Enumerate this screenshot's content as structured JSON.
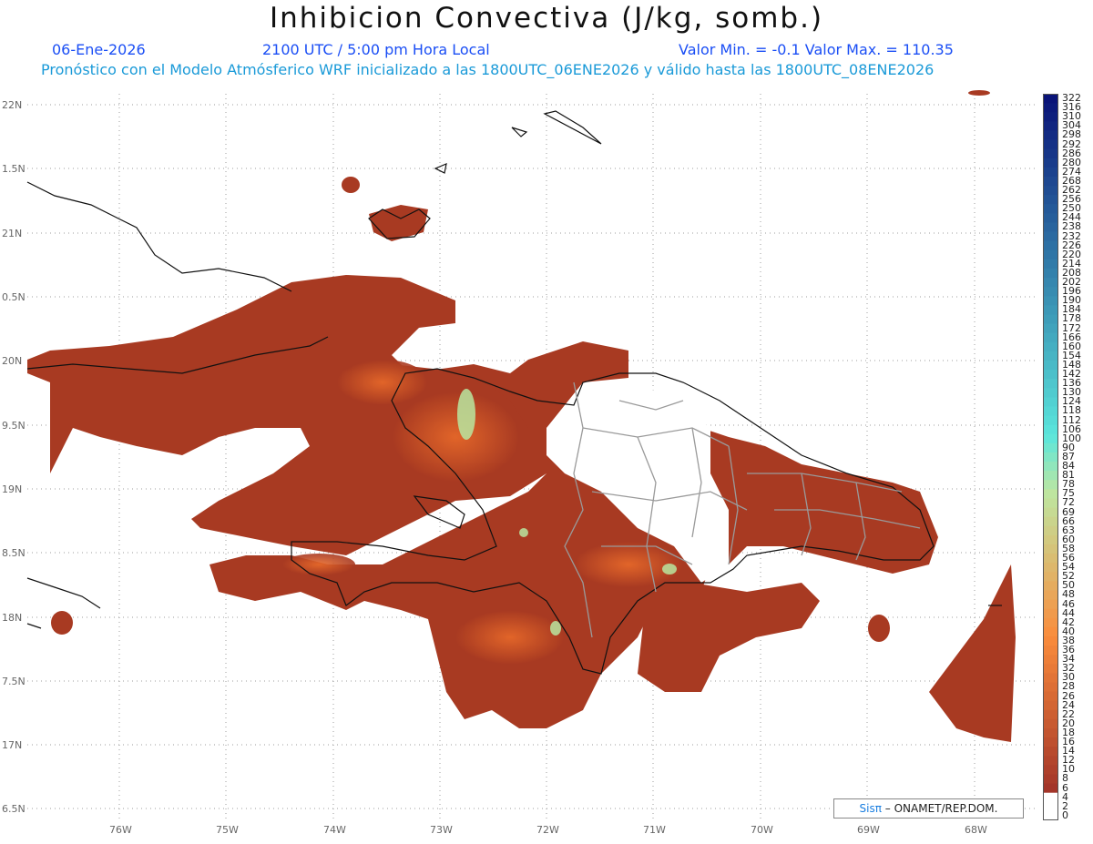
{
  "header": {
    "title": "Inhibicion Convectiva (J/kg, somb.)",
    "date": "06-Ene-2026",
    "time": "2100 UTC / 5:00 pm Hora Local",
    "minmax": "Valor Min. = -0.1  Valor Max. = 110.35",
    "forecast": "Pronóstico con el Modelo Atmósferico WRF inicializado a las 1800UTC_06ENE2026 y válido hasta las  1800UTC_08ENE2026"
  },
  "axes": {
    "lat_labels": [
      "22N",
      "1.5N",
      "21N",
      "0.5N",
      "20N",
      "9.5N",
      "19N",
      "8.5N",
      "18N",
      "7.5N",
      "17N",
      "6.5N"
    ],
    "lon_labels": [
      "76W",
      "75W",
      "74W",
      "73W",
      "72W",
      "71W",
      "70W",
      "69W",
      "68W"
    ]
  },
  "credit": {
    "brand": "Sisπ",
    "text": "– ONAMET/REP.DOM."
  },
  "colorbar": {
    "labels": [
      "322",
      "316",
      "310",
      "304",
      "298",
      "292",
      "286",
      "280",
      "274",
      "268",
      "262",
      "256",
      "250",
      "244",
      "238",
      "232",
      "226",
      "220",
      "214",
      "208",
      "202",
      "196",
      "190",
      "184",
      "178",
      "172",
      "166",
      "160",
      "154",
      "148",
      "142",
      "136",
      "130",
      "124",
      "118",
      "112",
      "106",
      "100",
      "90",
      "87",
      "84",
      "81",
      "78",
      "75",
      "72",
      "69",
      "66",
      "63",
      "60",
      "58",
      "56",
      "54",
      "52",
      "50",
      "48",
      "46",
      "44",
      "42",
      "40",
      "38",
      "36",
      "34",
      "32",
      "30",
      "28",
      "26",
      "24",
      "22",
      "20",
      "18",
      "16",
      "14",
      "12",
      "10",
      "8",
      "6",
      "4",
      "2",
      "0"
    ]
  },
  "colors": {
    "land_fill": "#a83a22",
    "land_hot": "#d9501e",
    "peak": "#b8e6a0",
    "coast": "#111111",
    "borders": "#9a9a9a"
  }
}
